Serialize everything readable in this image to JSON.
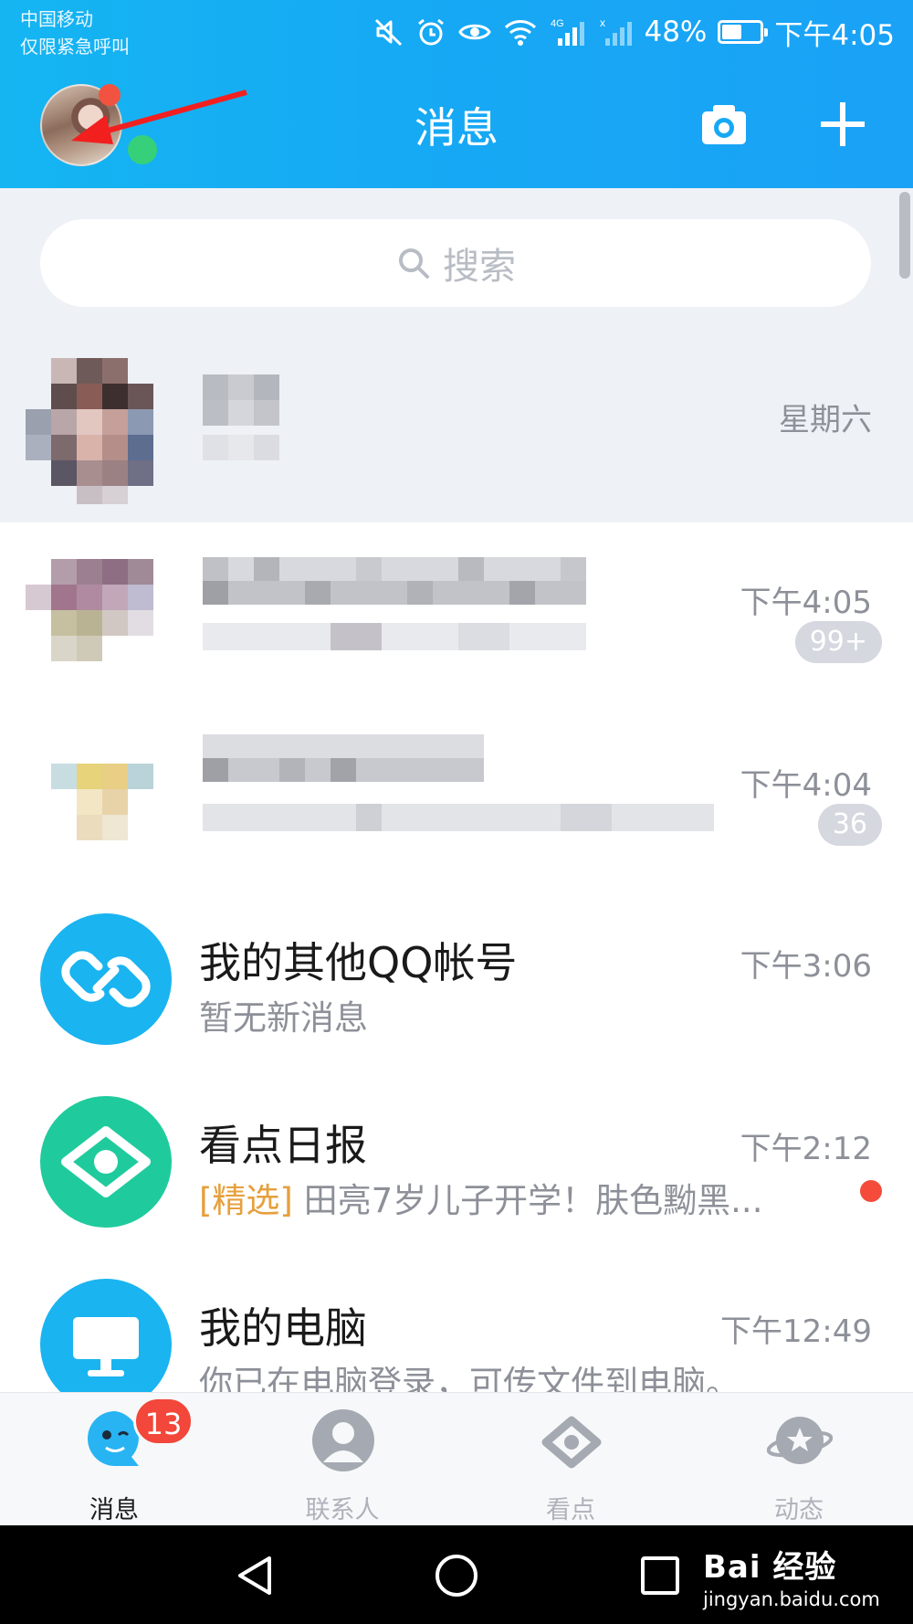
{
  "status_bar": {
    "carrier": "中国移动",
    "emergency": "仅限紧急呼叫",
    "network": "4G",
    "battery": "48%",
    "time": "下午4:05"
  },
  "header": {
    "title": "消息"
  },
  "search": {
    "placeholder": "搜索"
  },
  "chats": [
    {
      "time": "星期六"
    },
    {
      "time": "下午4:05",
      "badge": "99+"
    },
    {
      "time": "下午4:04",
      "badge": "36"
    },
    {
      "name": "我的其他QQ帐号",
      "preview": "暂无新消息",
      "time": "下午3:06",
      "icon": "link-icon",
      "icon_color": "#1ab4f0"
    },
    {
      "name": "看点日报",
      "preview_tag": "[精选]",
      "preview": " 田亮7岁儿子开学！肤色黝黑...",
      "time": "下午2:12",
      "icon": "eye-icon",
      "icon_color": "#1fcb9c",
      "unread_dot": true
    },
    {
      "name": "我的电脑",
      "preview": "你已在电脑登录，可传文件到电脑。",
      "time": "下午12:49",
      "icon": "monitor-icon",
      "icon_color": "#1ab4f0"
    }
  ],
  "tabs": [
    {
      "label": "消息",
      "icon": "penguin-icon",
      "badge": "13",
      "active": true
    },
    {
      "label": "联系人",
      "icon": "contacts-icon"
    },
    {
      "label": "看点",
      "icon": "eye-icon"
    },
    {
      "label": "动态",
      "icon": "star-planet-icon"
    }
  ],
  "watermark": {
    "brand": "Bai 经验",
    "url": "jingyan.baidu.com"
  },
  "colors": {
    "header_blue": "#16a9f4",
    "accent_red": "#f2473a",
    "tag_orange": "#e6a03d"
  }
}
